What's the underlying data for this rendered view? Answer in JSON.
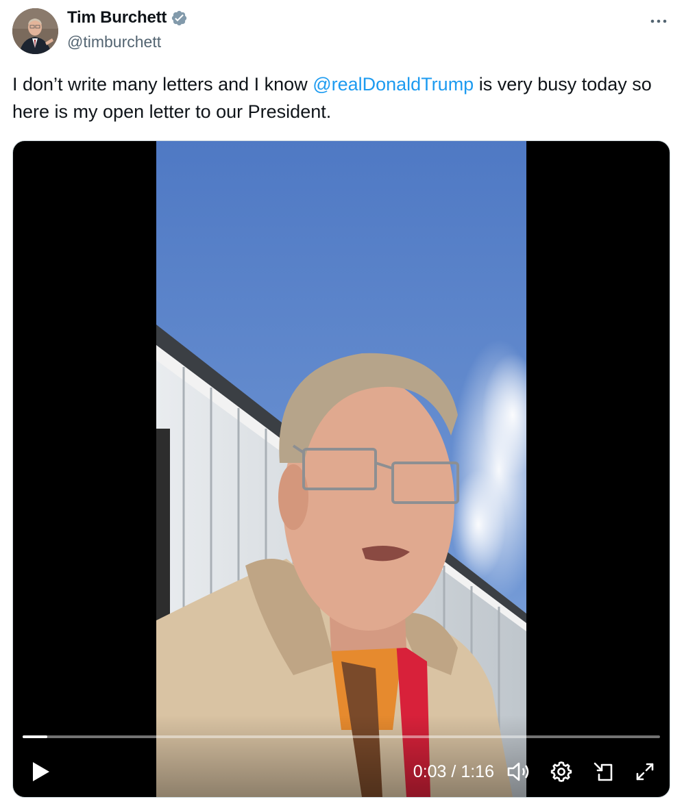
{
  "author": {
    "display_name": "Tim Burchett",
    "handle": "@timburchett",
    "verified": true,
    "verified_color": "#829aab"
  },
  "more_icon": "more-horizontal-icon",
  "tweet": {
    "text_before": "I don’t write many letters and I know ",
    "mention": "@realDonaldTrump",
    "text_after": " is very busy today so here is my open letter to our President."
  },
  "video": {
    "current_time": "0:03",
    "separator": "/",
    "duration": "1:16",
    "progress_fraction": 0.039,
    "controls": [
      "play-icon",
      "volume-icon",
      "settings-gear-icon",
      "picture-in-picture-icon",
      "fullscreen-icon"
    ]
  },
  "colors": {
    "mention": "#1d9bf0",
    "text": "#0f1419",
    "secondary": "#536471"
  }
}
